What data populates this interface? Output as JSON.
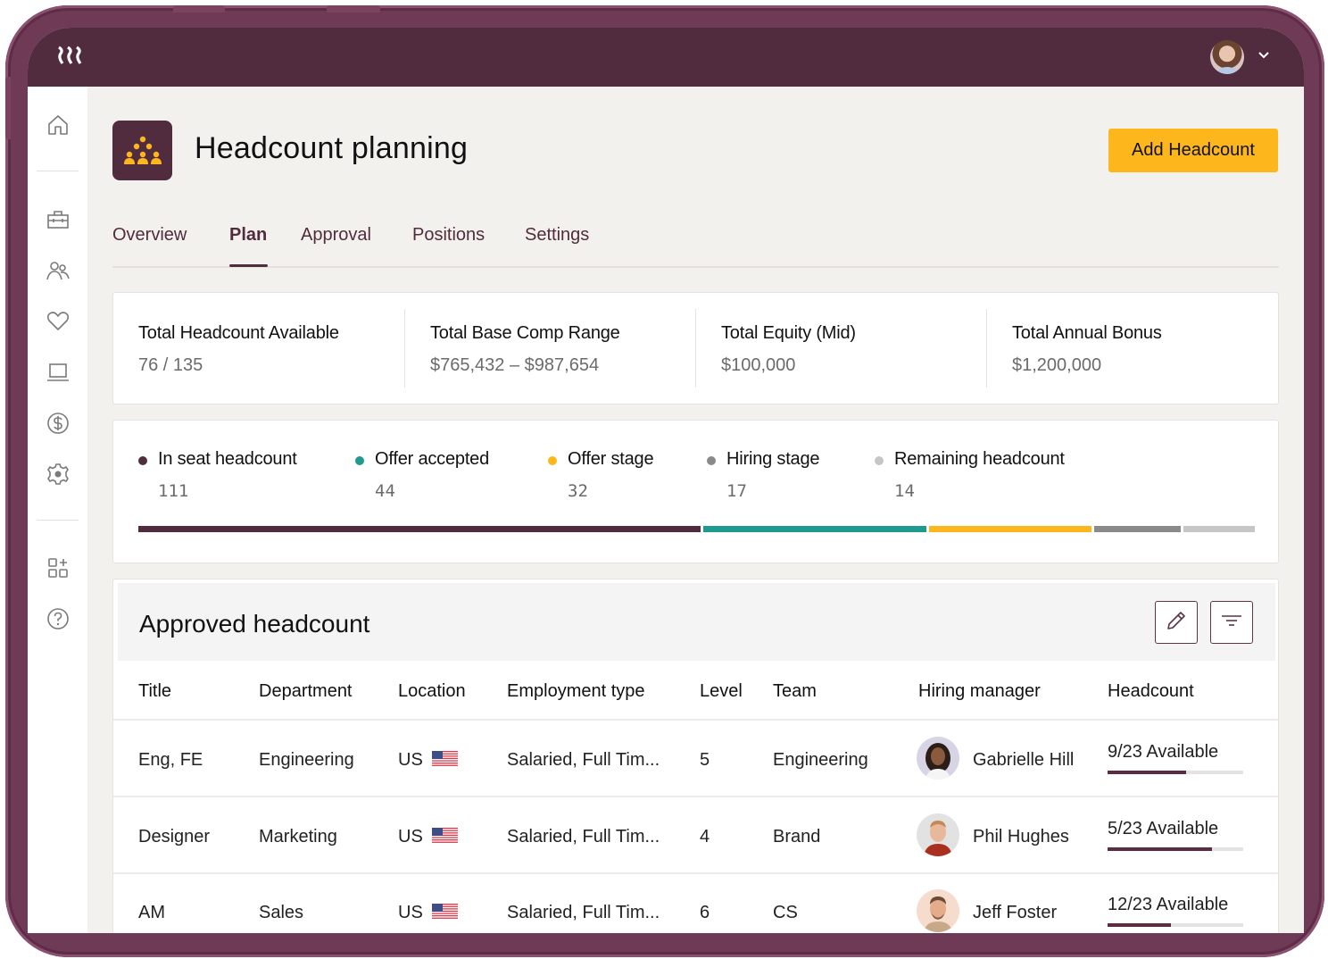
{
  "app": {
    "logo_icon": "rippling-logo-icon",
    "user_avatar": "user-avatar",
    "menu_icon": "chevron-down-icon"
  },
  "sidebar": {
    "items": [
      {
        "name": "home",
        "icon": "home-icon"
      },
      {
        "name": "work",
        "icon": "briefcase-icon"
      },
      {
        "name": "people",
        "icon": "people-icon"
      },
      {
        "name": "benefits",
        "icon": "heart-icon"
      },
      {
        "name": "devices",
        "icon": "laptop-icon"
      },
      {
        "name": "payroll",
        "icon": "dollar-icon"
      },
      {
        "name": "settings",
        "icon": "gear-icon"
      },
      {
        "name": "add-apps",
        "icon": "apps-add-icon"
      },
      {
        "name": "help",
        "icon": "help-icon"
      }
    ]
  },
  "header": {
    "app_icon": "headcount-icon",
    "title": "Headcount planning",
    "add_button": "Add Headcount"
  },
  "tabs": [
    {
      "label": "Overview",
      "active": false
    },
    {
      "label": "Plan",
      "active": true
    },
    {
      "label": "Approval",
      "active": false
    },
    {
      "label": "Positions",
      "active": false
    },
    {
      "label": "Settings",
      "active": false
    }
  ],
  "stats": [
    {
      "label": "Total Headcount Available",
      "value": "76 / 135"
    },
    {
      "label": "Total Base Comp Range",
      "value": "$765,432 – $987,654"
    },
    {
      "label": "Total Equity (Mid)",
      "value": "$100,000"
    },
    {
      "label": "Total Annual Bonus",
      "value": "$1,200,000"
    }
  ],
  "pipeline": {
    "total": 218,
    "segments": [
      {
        "label": "In seat headcount",
        "value": "111",
        "count": 111,
        "color": "#512c3e"
      },
      {
        "label": "Offer accepted",
        "value": "44",
        "count": 44,
        "color": "#1f9a8e"
      },
      {
        "label": "Offer stage",
        "value": "32",
        "count": 32,
        "color": "#fdb71c"
      },
      {
        "label": "Hiring stage",
        "value": "17",
        "count": 17,
        "color": "#8a8a8a"
      },
      {
        "label": "Remaining headcount",
        "value": "14",
        "count": 14,
        "color": "#c6c6c6"
      }
    ]
  },
  "table": {
    "title": "Approved headcount",
    "edit_icon": "pencil-icon",
    "filter_icon": "filter-icon",
    "columns": [
      "Title",
      "Department",
      "Location",
      "Employment type",
      "Level",
      "Team",
      "Hiring manager",
      "Headcount"
    ],
    "rows": [
      {
        "title": "Eng, FE",
        "department": "Engineering",
        "location": "US",
        "employment_type": "Salaried, Full Tim...",
        "level": "5",
        "team": "Engineering",
        "manager": "Gabrielle Hill",
        "headcount": "9/23 Available",
        "fill": 0.58
      },
      {
        "title": "Designer",
        "department": "Marketing",
        "location": "US",
        "employment_type": "Salaried, Full Tim...",
        "level": "4",
        "team": "Brand",
        "manager": "Phil Hughes",
        "headcount": "5/23 Available",
        "fill": 0.77
      },
      {
        "title": "AM",
        "department": "Sales",
        "location": "US",
        "employment_type": "Salaried, Full Tim...",
        "level": "6",
        "team": "CS",
        "manager": "Jeff Foster",
        "headcount": "12/23 Available",
        "fill": 0.47
      }
    ]
  }
}
